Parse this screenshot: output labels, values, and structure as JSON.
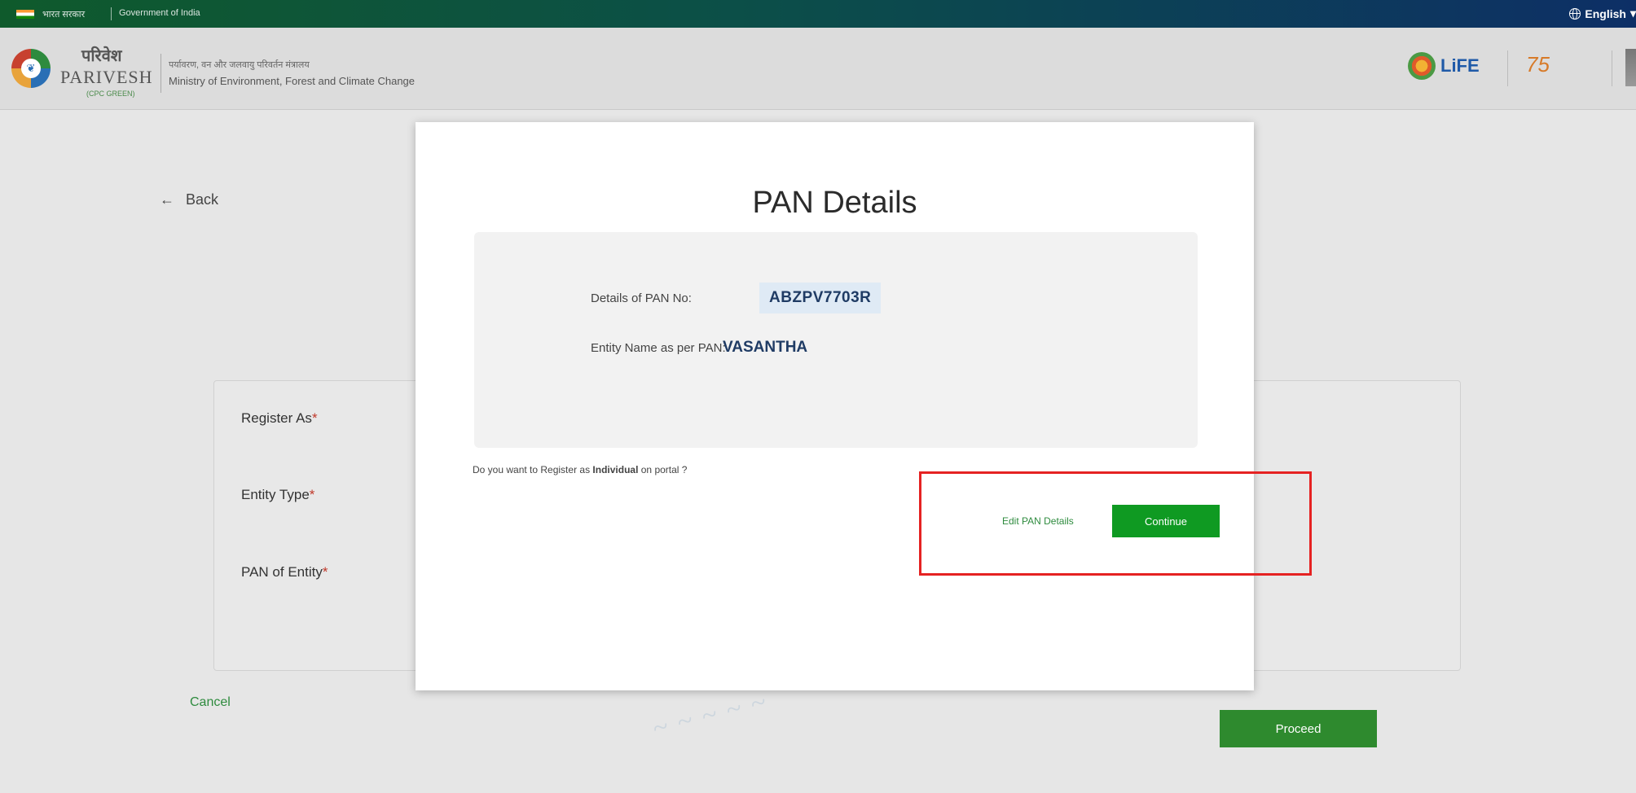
{
  "gov_bar": {
    "hindi_label": "भारत सरकार",
    "english_label": "Government of India",
    "language": "English",
    "language_caret": "▾"
  },
  "header": {
    "brand_hindi": "परिवेश",
    "brand_english": "PARIVESH",
    "brand_sub": "(CPC GREEN)",
    "ministry_hindi": "पर्यावरण, वन और जलवायु परिवर्तन मंत्रालय",
    "ministry_english": "Ministry of Environment, Forest and Climate Change",
    "life_logo": "LiFE"
  },
  "page": {
    "back_label": "Back",
    "back_icon": "←",
    "form_labels": [
      "Register As",
      "Entity Type",
      "PAN of Entity"
    ],
    "required_marker": "*",
    "cancel_label": "Cancel",
    "proceed_label": "Proceed"
  },
  "modal": {
    "title": "PAN Details",
    "pan_label": "Details of PAN No:",
    "pan_value": "ABZPV7703R",
    "entity_label": "Entity Name as per PAN:",
    "entity_value": "VASANTHA",
    "question_prefix": "Do you want to Register as ",
    "question_bold": "Individual",
    "question_suffix": " on portal ?",
    "edit_label": "Edit PAN Details",
    "continue_label": "Continue"
  },
  "colors": {
    "accent_green": "#2e8a2e",
    "highlight_red": "#e52222",
    "pan_text": "#1f3b64"
  }
}
